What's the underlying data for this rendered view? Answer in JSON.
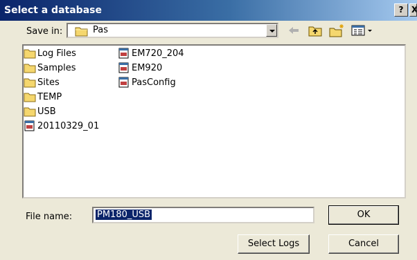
{
  "window": {
    "title": "Select a database",
    "help_label": "?",
    "close_label": "X"
  },
  "toolbar": {
    "save_in_label": "Save in:",
    "current_folder": "Pas"
  },
  "files": [
    {
      "name": "Log Files",
      "type": "folder"
    },
    {
      "name": "Samples",
      "type": "folder"
    },
    {
      "name": "Sites",
      "type": "folder"
    },
    {
      "name": "TEMP",
      "type": "folder"
    },
    {
      "name": "USB",
      "type": "folder"
    },
    {
      "name": "20110329_01",
      "type": "database"
    },
    {
      "name": "EM720_204",
      "type": "database"
    },
    {
      "name": "EM920",
      "type": "database"
    },
    {
      "name": "PasConfig",
      "type": "database"
    }
  ],
  "footer": {
    "file_name_label": "File name:",
    "file_name_value": "PM180_USB",
    "ok_label": "OK",
    "select_logs_label": "Select Logs",
    "cancel_label": "Cancel"
  },
  "colors": {
    "title_bar_start": "#0a246a",
    "title_bar_end": "#a6caf0",
    "dialog_background": "#ece9d8",
    "folder_yellow": "#f5d76e",
    "selection": "#0a246a"
  }
}
